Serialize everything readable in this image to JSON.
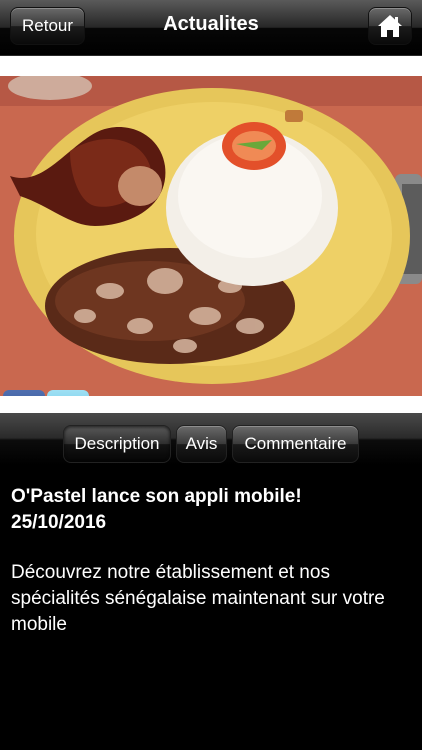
{
  "header": {
    "back_label": "Retour",
    "title": "Actualites"
  },
  "social": {
    "facebook_glyph": "f"
  },
  "tabs": [
    {
      "label": "Description",
      "active": true
    },
    {
      "label": "Avis",
      "active": false
    },
    {
      "label": "Commentaire",
      "active": false
    }
  ],
  "article": {
    "headline": "O'Pastel lance son appli mobile!",
    "date": "25/10/2016",
    "body": "Découvrez notre établissement et nos spécialités sénégalaise maintenant sur votre mobile"
  },
  "colors": {
    "background": "#000000",
    "facebook": "#3b5998",
    "twitter": "#55c3e8"
  }
}
